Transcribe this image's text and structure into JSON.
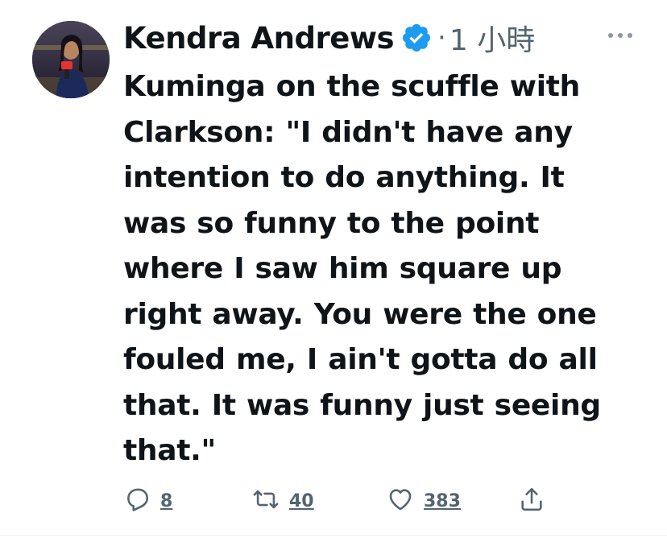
{
  "tweet": {
    "display_name": "Kendra Andrews",
    "separator": "·",
    "timestamp": "1 小時",
    "text": "Kuminga on the scuffle with\nClarkson: \"I didn't have any\nintention to do anything. It\nwas so funny to the point\nwhere I saw him square up\nright away. You were the one\nfouled me, I ain't gotta do all\nthat. It was funny just seeing\nthat.\"",
    "verified": true,
    "verified_icon": "verified-badge-icon",
    "more_icon": "more-dots-icon"
  },
  "actions": {
    "reply": {
      "icon": "reply-icon",
      "count": "8"
    },
    "retweet": {
      "icon": "retweet-icon",
      "count": "40"
    },
    "like": {
      "icon": "heart-icon",
      "count": "383"
    },
    "share": {
      "icon": "share-icon"
    }
  },
  "colors": {
    "text": "#0f1419",
    "secondary": "#536471",
    "verified": "#1d9bf0"
  }
}
